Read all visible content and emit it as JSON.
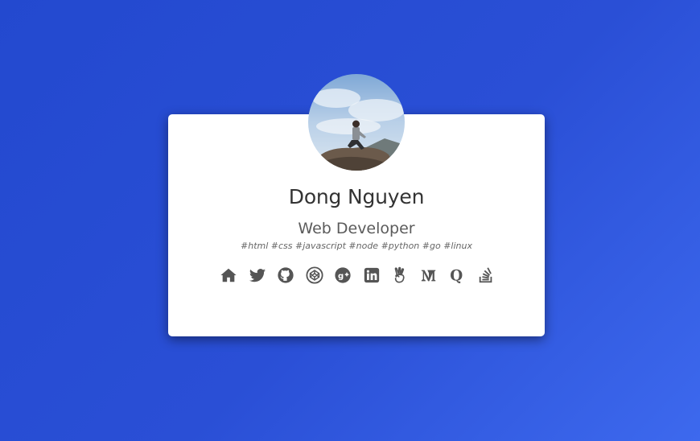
{
  "profile": {
    "name": "Dong Nguyen",
    "title": "Web Developer",
    "tags": "#html #css #javascript #node #python #go #linux"
  },
  "social_links": [
    {
      "icon": "home-icon"
    },
    {
      "icon": "twitter-icon"
    },
    {
      "icon": "github-icon"
    },
    {
      "icon": "codepen-icon"
    },
    {
      "icon": "google-plus-icon"
    },
    {
      "icon": "linkedin-icon"
    },
    {
      "icon": "angellist-icon"
    },
    {
      "icon": "medium-icon"
    },
    {
      "icon": "quora-icon"
    },
    {
      "icon": "stackoverflow-icon"
    }
  ],
  "colors": {
    "background_start": "#2349cf",
    "background_end": "#3d69ee",
    "card": "#ffffff",
    "name_text": "#333333",
    "icon": "#555555"
  }
}
